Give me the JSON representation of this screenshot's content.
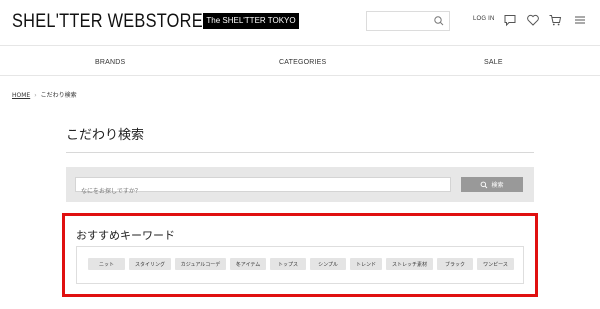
{
  "header": {
    "logo": "SHEL'TTER WEBSTORE",
    "badge": "The SHEL'TTER TOKYO",
    "search_placeholder": "",
    "login": "LOG IN",
    "icons": [
      "search-icon",
      "message-icon",
      "heart-icon",
      "cart-icon",
      "menu-icon"
    ]
  },
  "nav": {
    "brands": "BRANDS",
    "categories": "CATEGORIES",
    "sale": "SALE"
  },
  "breadcrumb": {
    "home": "HOME",
    "current": "こだわり検索"
  },
  "page": {
    "title": "こだわり検索"
  },
  "search": {
    "placeholder": "なにをお探しですか？",
    "button": "検索"
  },
  "keywords": {
    "title": "おすすめキーワード",
    "items": [
      "ニット",
      "スタイリング",
      "カジュアルコーデ",
      "冬アイテム",
      "トップス",
      "シンプル",
      "トレンド",
      "ストレッチ素材",
      "ブラック",
      "ワンピース"
    ]
  },
  "colors": {
    "highlight": "#e01010",
    "search_button": "#999999",
    "search_panel": "#e7e7e7",
    "chip": "#e4e4e4",
    "badge": "#000000"
  }
}
